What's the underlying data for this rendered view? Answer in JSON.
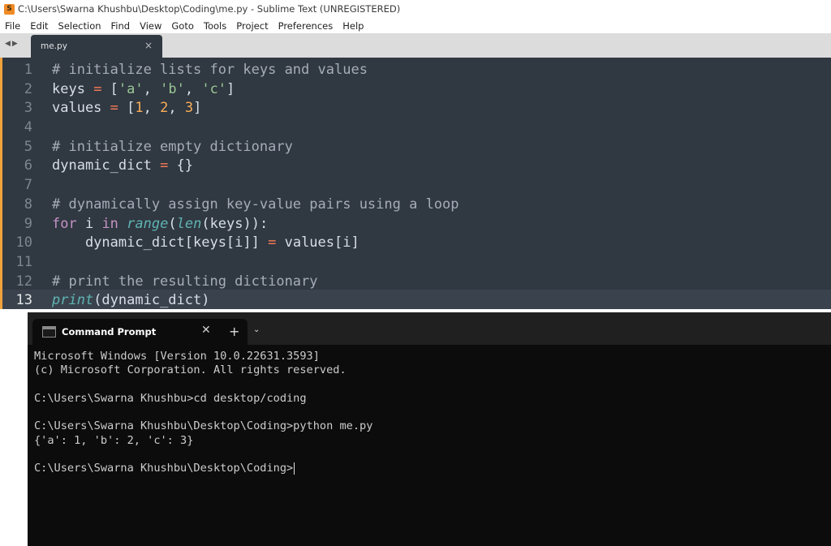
{
  "window": {
    "title": "C:\\Users\\Swarna Khushbu\\Desktop\\Coding\\me.py - Sublime Text (UNREGISTERED)"
  },
  "menu": [
    "File",
    "Edit",
    "Selection",
    "Find",
    "View",
    "Goto",
    "Tools",
    "Project",
    "Preferences",
    "Help"
  ],
  "tabs": [
    {
      "label": "me.py",
      "active": true
    }
  ],
  "editor": {
    "current_line": 13,
    "line_numbers": [
      "1",
      "2",
      "3",
      "4",
      "5",
      "6",
      "7",
      "8",
      "9",
      "10",
      "11",
      "12",
      "13"
    ],
    "lines": [
      [
        {
          "t": "# initialize lists for keys and values",
          "c": "cm"
        }
      ],
      [
        {
          "t": "keys ",
          "c": "pu"
        },
        {
          "t": "=",
          "c": "op"
        },
        {
          "t": " [",
          "c": "pu"
        },
        {
          "t": "'a'",
          "c": "str"
        },
        {
          "t": ", ",
          "c": "pu"
        },
        {
          "t": "'b'",
          "c": "str"
        },
        {
          "t": ", ",
          "c": "pu"
        },
        {
          "t": "'c'",
          "c": "str"
        },
        {
          "t": "]",
          "c": "pu"
        }
      ],
      [
        {
          "t": "values ",
          "c": "pu"
        },
        {
          "t": "=",
          "c": "op"
        },
        {
          "t": " [",
          "c": "pu"
        },
        {
          "t": "1",
          "c": "num"
        },
        {
          "t": ", ",
          "c": "pu"
        },
        {
          "t": "2",
          "c": "num"
        },
        {
          "t": ", ",
          "c": "pu"
        },
        {
          "t": "3",
          "c": "num"
        },
        {
          "t": "]",
          "c": "pu"
        }
      ],
      [],
      [
        {
          "t": "# initialize empty dictionary",
          "c": "cm"
        }
      ],
      [
        {
          "t": "dynamic_dict ",
          "c": "pu"
        },
        {
          "t": "=",
          "c": "op"
        },
        {
          "t": " {}",
          "c": "pu"
        }
      ],
      [],
      [
        {
          "t": "# dynamically assign key-value pairs using a loop",
          "c": "cm"
        }
      ],
      [
        {
          "t": "for",
          "c": "kw"
        },
        {
          "t": " i ",
          "c": "pu"
        },
        {
          "t": "in",
          "c": "kw"
        },
        {
          "t": " ",
          "c": "pu"
        },
        {
          "t": "range",
          "c": "fn"
        },
        {
          "t": "(",
          "c": "pu"
        },
        {
          "t": "len",
          "c": "fn"
        },
        {
          "t": "(keys)):",
          "c": "pu"
        }
      ],
      [
        {
          "t": "    dynamic_dict[keys[i]] ",
          "c": "pu"
        },
        {
          "t": "=",
          "c": "op"
        },
        {
          "t": " values[i]",
          "c": "pu"
        }
      ],
      [],
      [
        {
          "t": "# print the resulting dictionary",
          "c": "cm"
        }
      ],
      [
        {
          "t": "print",
          "c": "fn"
        },
        {
          "t": "(dynamic_dict)",
          "c": "pu"
        }
      ]
    ]
  },
  "terminal": {
    "tab_label": "Command Prompt",
    "add_tab": "+",
    "lines": [
      "Microsoft Windows [Version 10.0.22631.3593]",
      "(c) Microsoft Corporation. All rights reserved.",
      "",
      "C:\\Users\\Swarna Khushbu>cd desktop/coding",
      "",
      "C:\\Users\\Swarna Khushbu\\Desktop\\Coding>python me.py",
      "{'a': 1, 'b': 2, 'c': 3}",
      "",
      "C:\\Users\\Swarna Khushbu\\Desktop\\Coding>"
    ]
  },
  "colors": {
    "editor_bg": "#303841",
    "accent": "#f2a23b",
    "terminal_bg": "#0c0c0c"
  }
}
